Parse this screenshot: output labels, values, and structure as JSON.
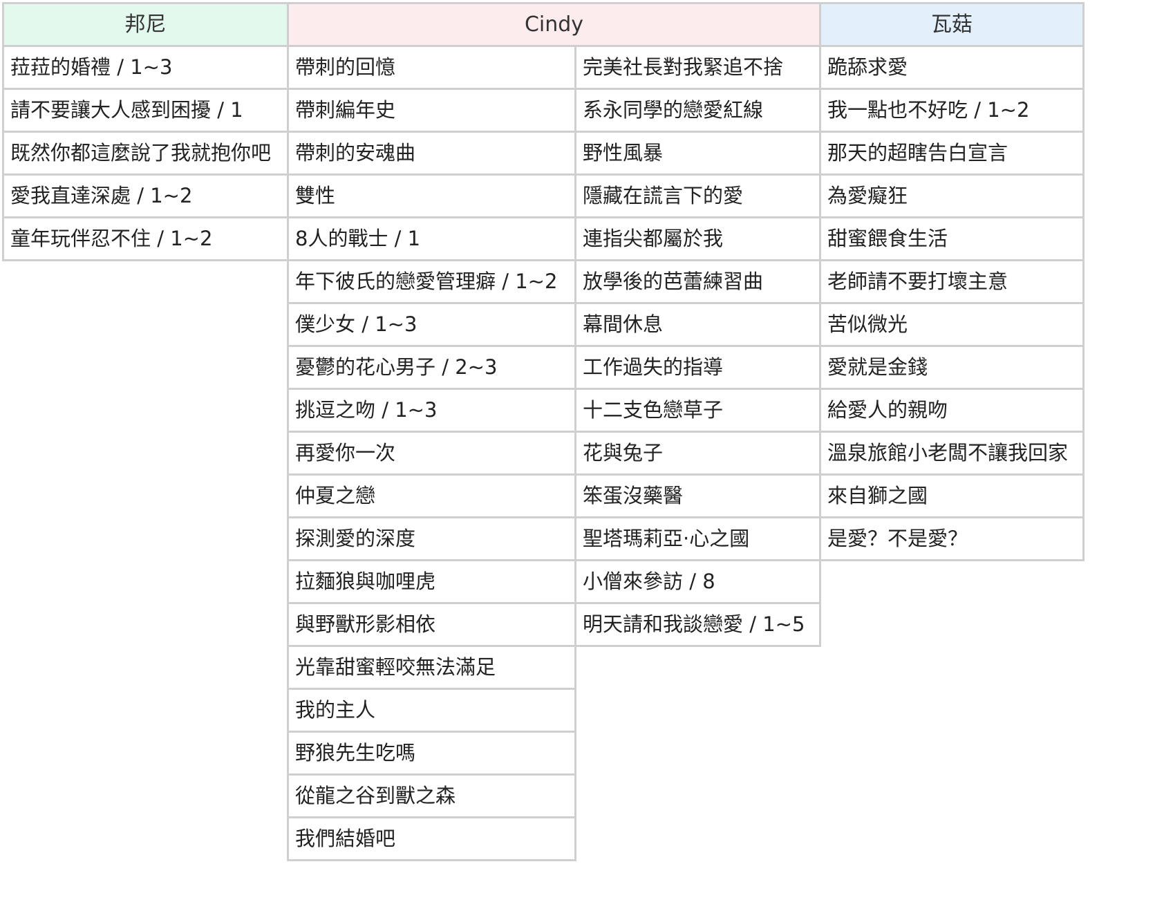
{
  "headers": {
    "bonnie": "邦尼",
    "cindy": "Cindy",
    "waguu": "瓦菇"
  },
  "header_colors": {
    "bonnie": "#e4f9ee",
    "cindy": "#fdeced",
    "waguu": "#e3f0fc",
    "border": "#cfcfcf"
  },
  "columns": {
    "bonnie": [
      "菈菈的婚禮 / 1~3",
      "請不要讓大人感到困擾 / 1",
      "既然你都這麼說了我就抱你吧",
      "愛我直達深處 / 1~2",
      "童年玩伴忍不住 / 1~2"
    ],
    "cindy_left": [
      "帶刺的回憶",
      "帶刺編年史",
      "帶刺的安魂曲",
      "雙性",
      "8人的戰士 / 1",
      "年下彼氏的戀愛管理癖 / 1~2",
      "僕少女 / 1~3",
      "憂鬱的花心男子 / 2~3",
      "挑逗之吻 / 1~3",
      "再愛你一次",
      "仲夏之戀",
      "探測愛的深度",
      "拉麵狼與咖哩虎",
      "與野獸形影相依",
      "光靠甜蜜輕咬無法滿足",
      "我的主人",
      "野狼先生吃嗎",
      "從龍之谷到獸之森",
      "我們結婚吧"
    ],
    "cindy_right": [
      "完美社長對我緊追不捨",
      "系永同學的戀愛紅線",
      "野性風暴",
      "隱藏在謊言下的愛",
      "連指尖都屬於我",
      "放學後的芭蕾練習曲",
      "幕間休息",
      "工作過失的指導",
      "十二支色戀草子",
      "花與兔子",
      "笨蛋沒藥醫",
      "聖塔瑪莉亞·心之國",
      "小僧來參訪 / 8",
      "明天請和我談戀愛 / 1~5"
    ],
    "waguu": [
      "跪舔求愛",
      "我一點也不好吃 / 1~2",
      "那天的超瞎告白宣言",
      "為愛癡狂",
      "甜蜜餵食生活",
      "老師請不要打壞主意",
      "苦似微光",
      "愛就是金錢",
      "給愛人的親吻",
      "溫泉旅館小老闆不讓我回家",
      "來自獅之國",
      "是愛？不是愛？"
    ]
  }
}
